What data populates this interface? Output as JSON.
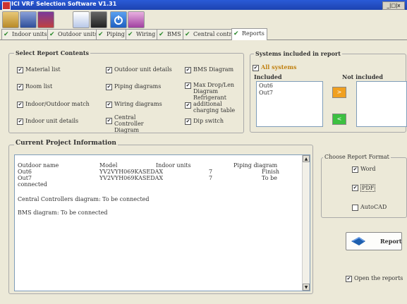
{
  "window": {
    "title": "ICI VRF Selection Software V1.31",
    "controls": "_|□|x"
  },
  "toolbar": {
    "buttons": [
      "open-folder-icon",
      "save-icon",
      "cube-icon",
      "document-icon",
      "printer-icon",
      "power-icon",
      "brush-icon"
    ]
  },
  "tabs": [
    "Indoor units",
    "Outdoor units",
    "Piping",
    "Wiring",
    "BMS",
    "Central control",
    "Reports"
  ],
  "select_report": {
    "title": "Select Report Contents",
    "items": [
      {
        "label": "Material list",
        "checked": true
      },
      {
        "label": "Outdoor unit details",
        "checked": true
      },
      {
        "label": "BMS Diagram",
        "checked": true
      },
      {
        "label": "Room list",
        "checked": true
      },
      {
        "label": "Piping diagrams",
        "checked": true
      },
      {
        "label": "Max Drop/Len Diagram",
        "checked": true
      },
      {
        "label": "Indoor/Outdoor match",
        "checked": true
      },
      {
        "label": "Wiring diagrams",
        "checked": true
      },
      {
        "label": "Refrigerant additional charging table",
        "checked": true
      },
      {
        "label": "Indoor unit details",
        "checked": true
      },
      {
        "label": "Central Controller Diagram",
        "checked": true
      },
      {
        "label": "Dip switch",
        "checked": true
      }
    ]
  },
  "systems": {
    "title": "Systems included in report",
    "all_systems_label": "All systems",
    "included_label": "Included",
    "not_included_label": "Not included",
    "included": [
      "Out6",
      "Out7"
    ],
    "not_included": [],
    "move_right": ">",
    "move_left": "<"
  },
  "project_info": {
    "title": "Current Project Information",
    "lines": [
      {
        "c1": "Outdoor name",
        "c2": "Model",
        "c3": "Indoor units",
        "c4": "",
        "c5": "Piping diagram"
      },
      {
        "c1": "Out6",
        "c2": "YV2VYH069KASEDAX",
        "c3": "",
        "c4": "7",
        "c5": "Finish"
      },
      {
        "c1": "Out7",
        "c2": "YV2VYH069KASEDAX",
        "c3": "",
        "c4": "7",
        "c5": "To be"
      },
      {
        "c1": "connected",
        "c2": "",
        "c3": "",
        "c4": "",
        "c5": ""
      },
      {
        "c1": "Central Controllers diagram: To be connected",
        "c2": "",
        "c3": "",
        "c4": "",
        "c5": ""
      },
      {
        "c1": "BMS diagram: To be connected",
        "c2": "",
        "c3": "",
        "c4": "",
        "c5": ""
      }
    ]
  },
  "format": {
    "title": "Choose Report Format",
    "options": [
      {
        "label": "Word",
        "checked": true
      },
      {
        "label": "PDF",
        "checked": true
      },
      {
        "label": "AutoCAD",
        "checked": false
      }
    ]
  },
  "report_button": "Report",
  "open_reports": {
    "label": "Open the reports",
    "checked": true
  },
  "colors": {
    "accent": "#2a5bd7",
    "check": "#2d8a2d",
    "arrow_right": "#f0a020",
    "arrow_left": "#3cc040"
  }
}
